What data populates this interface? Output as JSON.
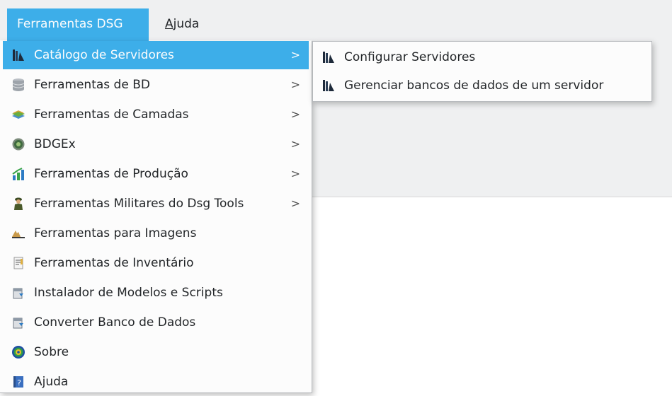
{
  "menubar": {
    "items": [
      {
        "label": "Ferramentas DSG",
        "mnemonic_prefix": "",
        "mnemonic": "",
        "rest": ""
      },
      {
        "label": "Ajuda",
        "mnemonic_prefix": "",
        "mnemonic": "A",
        "rest": "juda"
      }
    ]
  },
  "main_menu": {
    "items": [
      {
        "label": "Catálogo de Servidores",
        "icon": "server-catalog-icon",
        "submenu_arrow": ">"
      },
      {
        "label": "Ferramentas de BD",
        "icon": "database-icon",
        "submenu_arrow": ">"
      },
      {
        "label": "Ferramentas de Camadas",
        "icon": "layers-icon",
        "submenu_arrow": ">"
      },
      {
        "label": "BDGEx",
        "icon": "bdgex-globe-icon",
        "submenu_arrow": ">"
      },
      {
        "label": "Ferramentas de Produção",
        "icon": "production-chart-icon",
        "submenu_arrow": ">"
      },
      {
        "label": "Ferramentas Militares do Dsg Tools",
        "icon": "soldier-icon",
        "submenu_arrow": ">"
      },
      {
        "label": "Ferramentas para Imagens",
        "icon": "image-profile-icon"
      },
      {
        "label": "Ferramentas de Inventário",
        "icon": "inventory-document-icon"
      },
      {
        "label": "Instalador de Modelos e Scripts",
        "icon": "installer-icon"
      },
      {
        "label": "Converter Banco de Dados",
        "icon": "convert-database-icon"
      },
      {
        "label": "Sobre",
        "icon": "about-target-icon"
      },
      {
        "label": "Ajuda",
        "icon": "help-book-icon"
      }
    ]
  },
  "sub_menu": {
    "items": [
      {
        "label": "Configurar Servidores",
        "icon": "server-catalog-icon"
      },
      {
        "label": "Gerenciar bancos de dados de um servidor",
        "icon": "server-catalog-icon"
      }
    ]
  },
  "colors": {
    "highlight": "#3daee9",
    "menubar_bg": "#eff0f1",
    "menu_bg": "#fcfcfc",
    "text": "#232629"
  }
}
